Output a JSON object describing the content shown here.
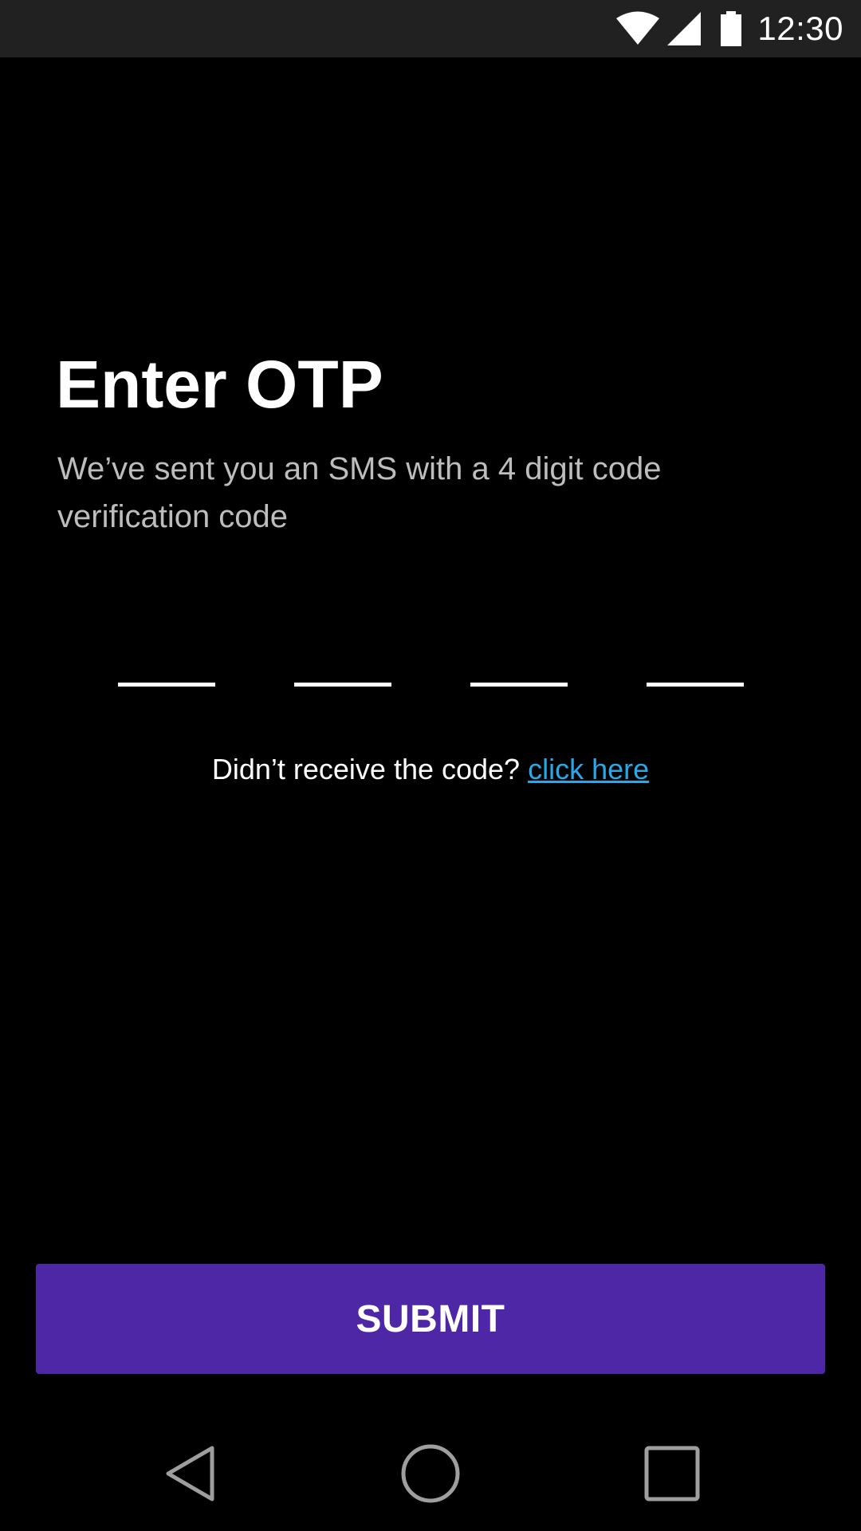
{
  "status_bar": {
    "time": "12:30",
    "icons": [
      "wifi-icon",
      "cell-signal-icon",
      "battery-icon"
    ]
  },
  "otp": {
    "title": "Enter OTP",
    "subtitle": "We’ve sent you an SMS with a 4 digit code verification code",
    "digits": [
      "",
      "",
      "",
      ""
    ],
    "resend_prompt": "Didn’t receive the code?",
    "resend_link": "click here",
    "submit_label": "SUBMIT"
  },
  "nav_bar": {
    "buttons": [
      "back-icon",
      "home-icon",
      "recents-icon"
    ]
  },
  "colors": {
    "background": "#000000",
    "status_bar": "#212121",
    "accent": "#4e27a6",
    "link": "#29a8e8",
    "subtitle_text": "#bdbdbd"
  }
}
